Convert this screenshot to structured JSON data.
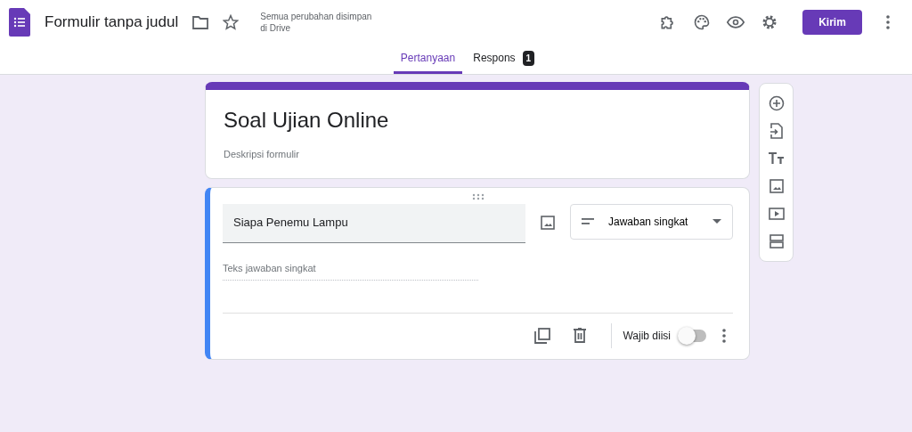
{
  "header": {
    "title": "Formulir tanpa judul",
    "save_status": "Semua perubahan disimpan di Drive",
    "send_button": "Kirim"
  },
  "tabs": [
    {
      "label": "Pertanyaan",
      "selected": true
    },
    {
      "label": "Respons",
      "selected": false,
      "badge": "1"
    }
  ],
  "form": {
    "title": "Soal Ujian Online",
    "description_placeholder": "Deskripsi formulir"
  },
  "question": {
    "title": "Siapa Penemu Lampu",
    "type": "Jawaban singkat",
    "answer_placeholder": "Teks jawaban singkat",
    "required_label": "Wajib diisi",
    "required": false
  }
}
